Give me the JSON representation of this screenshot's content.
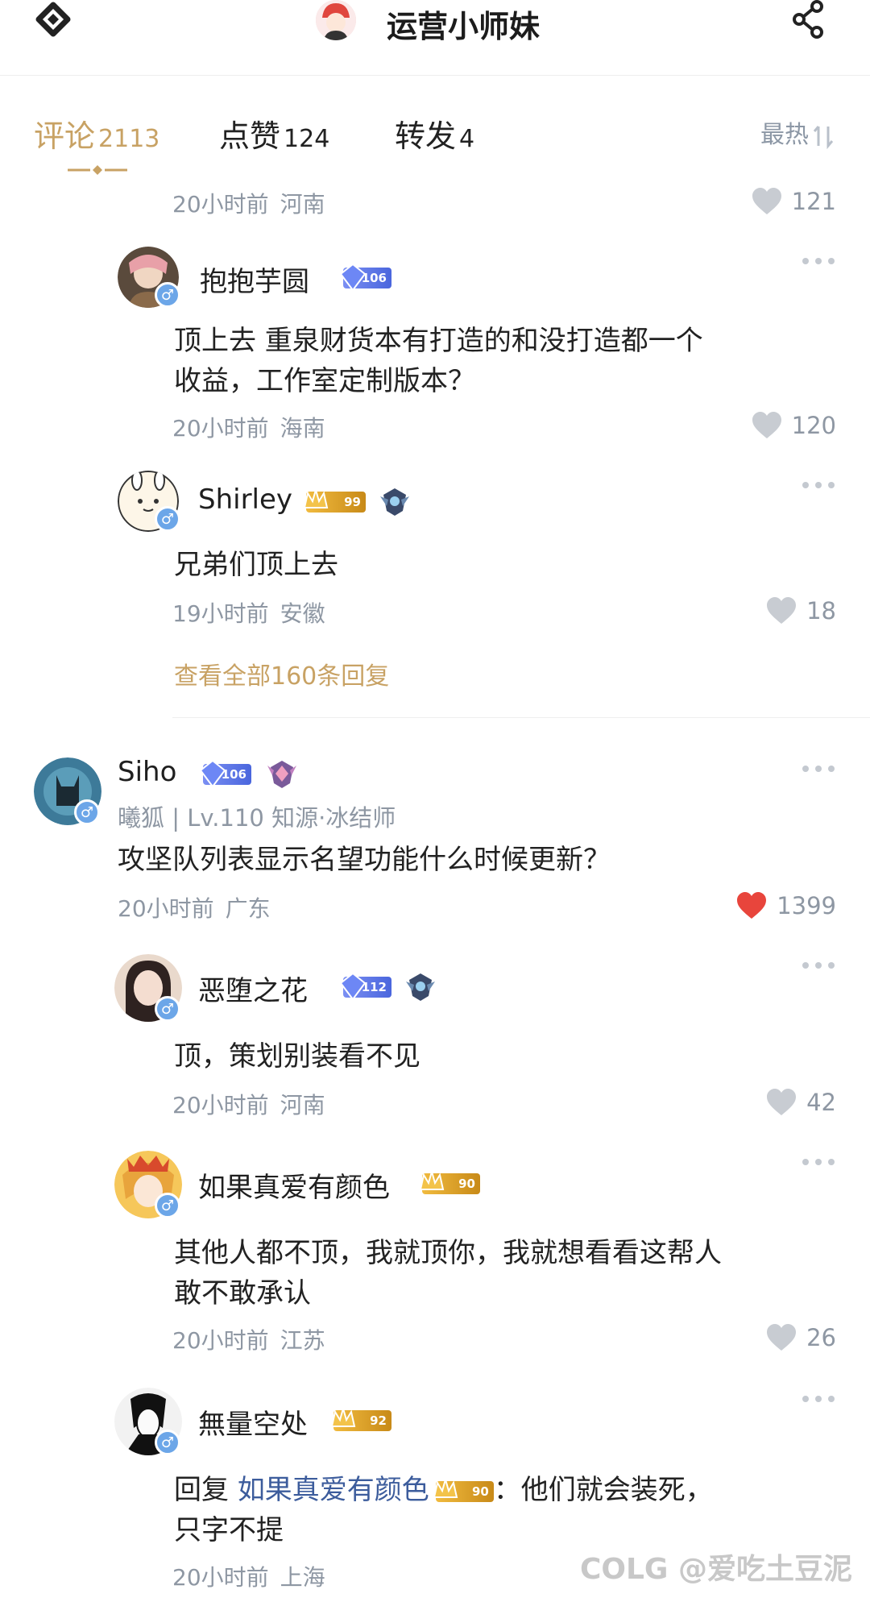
{
  "header": {
    "title": "运营小师妹"
  },
  "tabs": [
    {
      "label": "评论",
      "count": "2113"
    },
    {
      "label": "点赞",
      "count": "124"
    },
    {
      "label": "转发",
      "count": "4"
    }
  ],
  "sort_label": "最热",
  "top_partial": {
    "time": "20小时前",
    "location": "河南",
    "likes": "121"
  },
  "replies_group1": [
    {
      "username": "抱抱芋圆",
      "level": "106",
      "text_lines": [
        "顶上去 重泉财货本有打造的和没打造都一个",
        "收益，工作室定制版本？"
      ],
      "time": "20小时前",
      "location": "海南",
      "likes": "120"
    },
    {
      "username": "Shirley",
      "level": "99",
      "text_lines": [
        "兄弟们顶上去"
      ],
      "time": "19小时前",
      "location": "安徽",
      "likes": "18"
    }
  ],
  "view_all_replies": "查看全部160条回复",
  "main_comment": {
    "username": "Siho",
    "level": "106",
    "sub_info": "曦狐 | Lv.110 知源·冰结师",
    "text": "攻坚队列表显示名望功能什么时候更新？",
    "time": "20小时前",
    "location": "广东",
    "likes": "1399",
    "like_color": "#e8453c"
  },
  "replies_group2": [
    {
      "username": "恶堕之花",
      "level": "112",
      "text_lines": [
        "顶，策划别装看不见"
      ],
      "time": "20小时前",
      "location": "河南",
      "likes": "42"
    },
    {
      "username": "如果真爱有颜色",
      "level": "90",
      "text_lines": [
        "其他人都不顶，我就顶你，我就想看看这帮人",
        "敢不敢承认"
      ],
      "time": "20小时前",
      "location": "江苏",
      "likes": "26"
    },
    {
      "username": "無量空处",
      "level": "92",
      "reply_prefix": "回复",
      "reply_to": "如果真爱有颜色",
      "reply_to_level": "90",
      "reply_text": "：他们就会装死，",
      "reply_text_line2": "只字不提",
      "time": "20小时前",
      "location": "上海"
    }
  ],
  "watermark": "COLG @爱吃土豆泥",
  "colors": {
    "accent": "#c8a264",
    "meta": "#8e97a3",
    "link": "#3c5c9c",
    "gender": "#6ca6e8"
  }
}
